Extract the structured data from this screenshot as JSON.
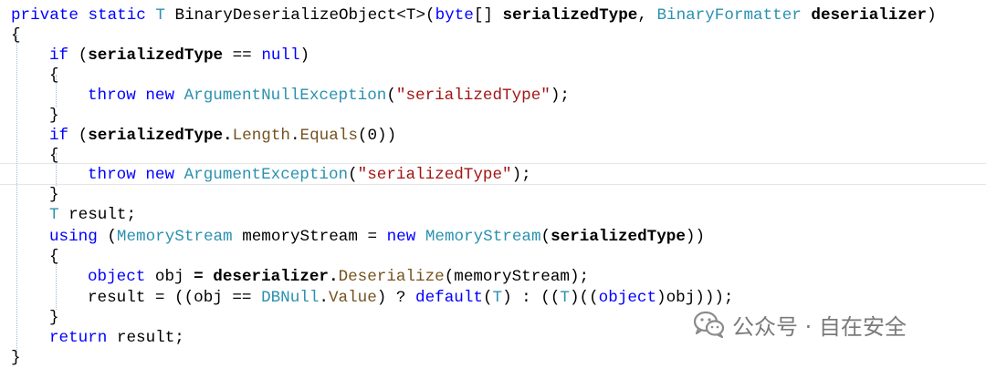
{
  "code": {
    "line1": {
      "kw_private": "private",
      "kw_static": "static",
      "t_type": "T",
      "method": "BinaryDeserializeObject",
      "generic": "<T>(",
      "kw_byte": "byte",
      "brackets": "[]",
      "p1": "serializedType",
      "comma": ",",
      "t_formatter": "BinaryFormatter",
      "p2": "deserializer",
      "close": ")"
    },
    "open_brace": "{",
    "close_brace": "}",
    "line3": {
      "kw_if": "if",
      "pre": "(",
      "var": "serializedType",
      "op": "==",
      "kw_null": "null",
      "post": ")"
    },
    "line5": {
      "kw_throw": "throw",
      "kw_new": "new",
      "type": "ArgumentNullException",
      "lp": "(",
      "str": "\"serializedType\"",
      "rp": ");"
    },
    "line7": {
      "kw_if": "if",
      "pre": "(",
      "var": "serializedType.",
      "prop": "Length",
      "dot": ".",
      "method": "Equals",
      "args": "(",
      "num": "0",
      "post": "))"
    },
    "line9": {
      "kw_throw": "throw",
      "kw_new": "new",
      "type": "ArgumentException",
      "lp": "(",
      "str": "\"serializedType\"",
      "rp": ");"
    },
    "line11": {
      "type": "T",
      "rest": "result;"
    },
    "line12": {
      "kw_using": "using",
      "lp": "(",
      "type": "MemoryStream",
      "var": "memoryStream",
      "eq": "=",
      "kw_new": "new",
      "type2": "MemoryStream",
      "lp2": "(",
      "arg": "serializedType",
      "rp": "))"
    },
    "line14": {
      "kw_object": "object",
      "var": "obj",
      "eq": "=",
      "recv": "deserializer.",
      "method": "Deserialize",
      "args": "(memoryStream);"
    },
    "line15": {
      "pre": "result = ((obj ==",
      "type": "DBNull",
      "dot": ".",
      "prop": "Value",
      "mid": ") ?",
      "kw_default": "default",
      "lp": "(",
      "t": "T",
      "colon": ") : ((",
      "t2": "T",
      "rp": ")((",
      "kw_object": "object",
      "end": ")obj)));"
    },
    "line17": {
      "kw_return": "return",
      "rest": "result;"
    }
  },
  "watermark": {
    "text": "公众号 · 自在安全",
    "icon": "wechat-icon"
  },
  "colors": {
    "keyword": "#0000ff",
    "type": "#2b91af",
    "string": "#a31515",
    "method": "#74531f",
    "watermark": "#7a7a7a"
  }
}
